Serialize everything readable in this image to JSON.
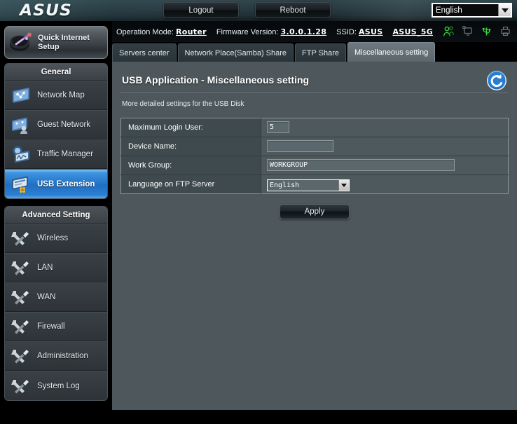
{
  "header": {
    "logo": "ASUS",
    "logout_label": "Logout",
    "reboot_label": "Reboot",
    "language": "English"
  },
  "status": {
    "operation_mode_label": "Operation Mode:",
    "operation_mode_value": "Router",
    "firmware_label": "Firmware Version:",
    "firmware_value": "3.0.0.1.28",
    "ssid_label": "SSID:",
    "ssid_value": "ASUS",
    "ssid_value_5g": "ASUS_5G",
    "icons": [
      {
        "name": "users-icon",
        "color": "#3bdc3b"
      },
      {
        "name": "monitor-icon",
        "color": "#6d7478"
      },
      {
        "name": "usb-icon",
        "color": "#3bdc3b"
      },
      {
        "name": "printer-icon",
        "color": "#6d7478"
      }
    ]
  },
  "quick_setup": {
    "line1": "Quick Internet",
    "line2": "Setup"
  },
  "tabs": [
    {
      "label": "Servers center",
      "active": false
    },
    {
      "label": "Network Place(Samba) Share",
      "active": false
    },
    {
      "label": "FTP Share",
      "active": false
    },
    {
      "label": "Miscellaneous setting",
      "active": true
    }
  ],
  "sidebar": {
    "groups": [
      {
        "title": "General",
        "items": [
          {
            "label": "Network Map",
            "icon": "network-map-icon",
            "active": false
          },
          {
            "label": "Guest Network",
            "icon": "guest-network-icon",
            "active": false
          },
          {
            "label": "Traffic Manager",
            "icon": "traffic-manager-icon",
            "active": false
          },
          {
            "label": "USB Extension",
            "icon": "usb-extension-icon",
            "active": true
          }
        ]
      },
      {
        "title": "Advanced Setting",
        "items": [
          {
            "label": "Wireless",
            "icon": "tools-icon",
            "active": false
          },
          {
            "label": "LAN",
            "icon": "tools-icon",
            "active": false
          },
          {
            "label": "WAN",
            "icon": "tools-icon",
            "active": false
          },
          {
            "label": "Firewall",
            "icon": "tools-icon",
            "active": false
          },
          {
            "label": "Administration",
            "icon": "tools-icon",
            "active": false
          },
          {
            "label": "System Log",
            "icon": "tools-icon",
            "active": false
          }
        ]
      }
    ]
  },
  "main": {
    "title": "USB Application - Miscellaneous setting",
    "description": "More detailed settings for the USB Disk",
    "refresh_icon": "refresh-icon",
    "fields": [
      {
        "label": "Maximum Login User:",
        "value": "5",
        "type": "text"
      },
      {
        "label": "Device Name:",
        "value": "",
        "type": "text"
      },
      {
        "label": "Work Group:",
        "value": "WORKGROUP",
        "type": "text"
      },
      {
        "label": "Language on FTP Server",
        "value": "English",
        "type": "select"
      }
    ],
    "apply_label": "Apply"
  },
  "colors": {
    "panel_bg": "#4e585c",
    "label_cell": "#3f4a4e",
    "accent_blue": "#2a80d2",
    "status_green": "#3bdc3b"
  }
}
